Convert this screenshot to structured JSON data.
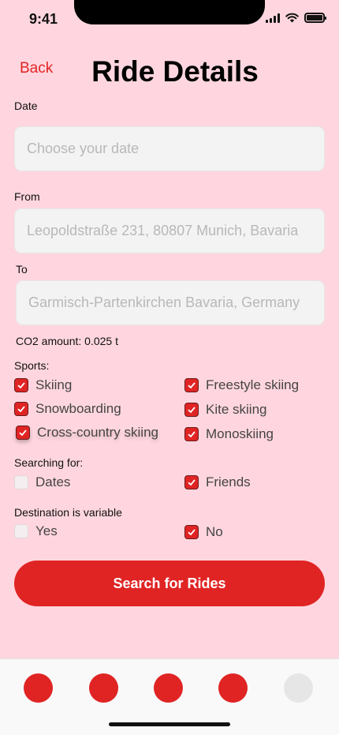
{
  "status": {
    "time": "9:41"
  },
  "header": {
    "back_label": "Back",
    "title": "Ride Details"
  },
  "form": {
    "date": {
      "label": "Date",
      "placeholder": "Choose your date"
    },
    "from": {
      "label": "From",
      "value": "Leopoldstraße 231, 80807 Munich, Bavaria"
    },
    "to": {
      "label": "To",
      "value": "Garmisch-Partenkirchen Bavaria, Germany"
    },
    "co2": "CO2 amount: 0.025 t"
  },
  "sports": {
    "label": "Sports:",
    "items": [
      {
        "label": "Skiing",
        "checked": true
      },
      {
        "label": "Freestyle skiing",
        "checked": true
      },
      {
        "label": "Snowboarding",
        "checked": true
      },
      {
        "label": "Kite skiing",
        "checked": true
      },
      {
        "label": "Cross-country skiing",
        "checked": true
      },
      {
        "label": "Monoskiing",
        "checked": true
      }
    ]
  },
  "searching": {
    "label": "Searching for:",
    "items": [
      {
        "label": "Dates",
        "checked": false
      },
      {
        "label": "Friends",
        "checked": true
      }
    ]
  },
  "destination": {
    "label": "Destination is variable",
    "items": [
      {
        "label": "Yes",
        "checked": false
      },
      {
        "label": "No",
        "checked": true
      }
    ]
  },
  "search_button": "Search for Rides",
  "colors": {
    "background": "#ffd6df",
    "accent": "#e02424",
    "inactive_tab": "#e6e6e6"
  },
  "tabs": [
    {
      "icon": "tab-icon",
      "active": true
    },
    {
      "icon": "tab-icon",
      "active": true
    },
    {
      "icon": "tab-icon",
      "active": true
    },
    {
      "icon": "tab-icon",
      "active": true
    },
    {
      "icon": "tab-icon",
      "active": false
    }
  ]
}
